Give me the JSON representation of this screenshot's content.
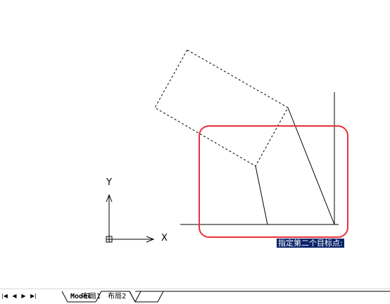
{
  "viewport": {
    "axis_y_label": "Y",
    "axis_x_label": "X",
    "prompt_tooltip": "指定第二个目标点:"
  },
  "tabs": {
    "nav_first": "|◀",
    "nav_prev": "◀",
    "nav_next": "▶",
    "nav_last": "▶|",
    "items": [
      {
        "label": "Model",
        "active": true
      },
      {
        "label": "布局1",
        "active": false
      },
      {
        "label": "布局2",
        "active": false
      }
    ]
  },
  "colors": {
    "highlight": "#e8303a",
    "tooltip_bg": "#0a246a"
  }
}
